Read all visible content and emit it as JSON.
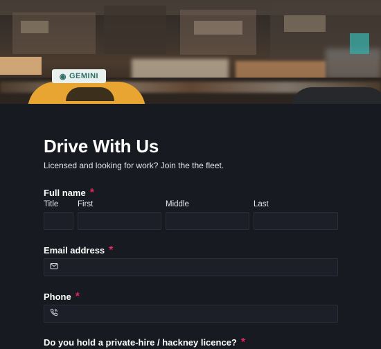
{
  "hero": {
    "taxi_sign": "GEMINI"
  },
  "form": {
    "title": "Drive With Us",
    "subtitle": "Licensed and looking for work? Join the the fleet.",
    "required_marker": "*",
    "full_name": {
      "label": "Full name",
      "parts": {
        "title": "Title",
        "first": "First",
        "middle": "Middle",
        "last": "Last"
      }
    },
    "email": {
      "label": "Email address",
      "icon": "mail-icon"
    },
    "phone": {
      "label": "Phone",
      "icon": "phone-icon"
    },
    "licence": {
      "label": "Do you hold a private-hire / hackney licence?"
    }
  },
  "colors": {
    "background": "#171a21",
    "input_bg": "#1c1f27",
    "required": "#e2275a"
  }
}
